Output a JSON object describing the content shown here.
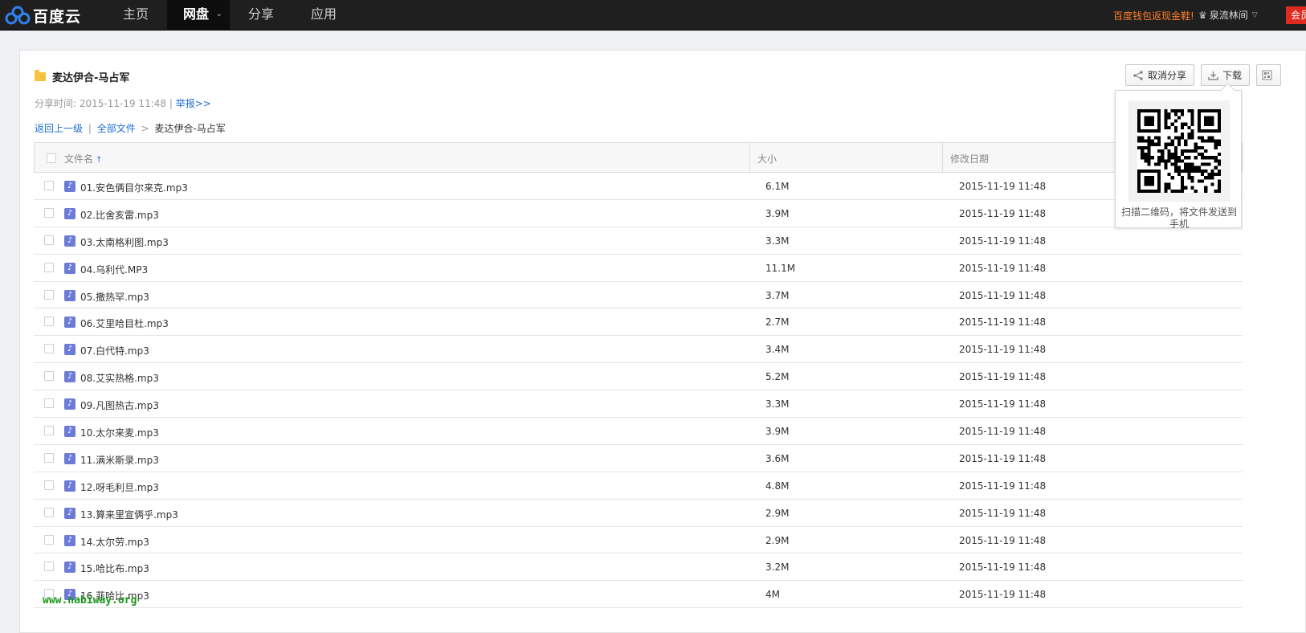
{
  "header": {
    "logo_text": "百度云",
    "nav": [
      {
        "label": "主页",
        "active": false
      },
      {
        "label": "网盘",
        "active": true,
        "caret": "⌄"
      },
      {
        "label": "分享",
        "active": false
      },
      {
        "label": "应用",
        "active": false
      }
    ],
    "promo": "百度钱包返现金鞋!",
    "username": "泉流林间",
    "vip_label": "会员"
  },
  "share": {
    "folder_name": "麦达伊合-马占军",
    "share_time_label": "分享时间:",
    "share_time": "2015-11-19 11:48",
    "report_link": "举报>>",
    "back_link": "返回上一级",
    "all_files_link": "全部文件",
    "crumb_sep": ">",
    "crumb_current": "麦达伊合-马占军"
  },
  "actions": {
    "cancel_share_label": "取消分享",
    "download_label": "下载"
  },
  "table": {
    "col_name": "文件名",
    "col_size": "大小",
    "col_date": "修改日期",
    "rows": [
      {
        "name": "01.安色俩目尔来克.mp3",
        "size": "6.1M",
        "date": "2015-11-19 11:48"
      },
      {
        "name": "02.比舍亥雷.mp3",
        "size": "3.9M",
        "date": "2015-11-19 11:48"
      },
      {
        "name": "03.太南格利图.mp3",
        "size": "3.3M",
        "date": "2015-11-19 11:48"
      },
      {
        "name": "04.乌利代.MP3",
        "size": "11.1M",
        "date": "2015-11-19 11:48"
      },
      {
        "name": "05.撒热罕.mp3",
        "size": "3.7M",
        "date": "2015-11-19 11:48"
      },
      {
        "name": "06.艾里哈目杜.mp3",
        "size": "2.7M",
        "date": "2015-11-19 11:48"
      },
      {
        "name": "07.白代特.mp3",
        "size": "3.4M",
        "date": "2015-11-19 11:48"
      },
      {
        "name": "08.艾实热格.mp3",
        "size": "5.2M",
        "date": "2015-11-19 11:48"
      },
      {
        "name": "09.凡图热古.mp3",
        "size": "3.3M",
        "date": "2015-11-19 11:48"
      },
      {
        "name": "10.太尔来麦.mp3",
        "size": "3.9M",
        "date": "2015-11-19 11:48"
      },
      {
        "name": "11.满米斯录.mp3",
        "size": "3.6M",
        "date": "2015-11-19 11:48"
      },
      {
        "name": "12.呀毛利旦.mp3",
        "size": "4.8M",
        "date": "2015-11-19 11:48"
      },
      {
        "name": "13.算来里宣俩乎.mp3",
        "size": "2.9M",
        "date": "2015-11-19 11:48"
      },
      {
        "name": "14.太尔劳.mp3",
        "size": "2.9M",
        "date": "2015-11-19 11:48"
      },
      {
        "name": "15.哈比布.mp3",
        "size": "3.2M",
        "date": "2015-11-19 11:48"
      },
      {
        "name": "16.菲哈比.mp3",
        "size": "4M",
        "date": "2015-11-19 11:48"
      }
    ]
  },
  "qr_popup": {
    "caption": "扫描二维码，将文件发送到手机"
  },
  "watermark": "www.nabiway.org",
  "colors": {
    "topbar": "#1f1f1f",
    "link": "#1e6fd6",
    "promo": "#ff7e2a",
    "vip": "#e02a20",
    "music_icon": "#6d7bd8",
    "folder": "#f6c340",
    "watermark": "#1a9a1a"
  }
}
